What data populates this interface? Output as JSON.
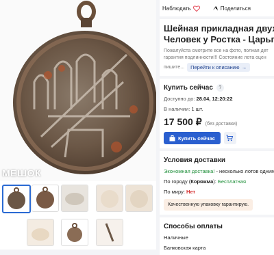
{
  "header": {
    "favorite_label": "Наблюдать",
    "share_label": "Поделиться"
  },
  "gallery": {
    "watermark": "МЕШОК"
  },
  "item": {
    "title_line1": "Шейная прикладная двухс",
    "title_line2": "Человек у Ростка - Царьгр",
    "desc_line1": "Пожалуйста смотрите все на фото, полная дет",
    "desc_line2": "гарантия подлинности!!! Состояние лота оцен",
    "desc_line3": "пишите...",
    "goto_desc_label": "Перейти к описанию"
  },
  "buy": {
    "section_title": "Купить сейчас",
    "help": "?",
    "available_label": "Доступно до:",
    "available_value": "28.04, 12:20:22",
    "stock_label": "В наличии:",
    "stock_value": "1 шт.",
    "price": "17 500 ₽",
    "price_note": "(без доставки)",
    "buy_button": "Купить сейчас"
  },
  "delivery": {
    "section_title": "Условия доставки",
    "economy_label": "Экономная доставка!",
    "economy_text": " - несколько лотов одним",
    "city_label": "По городу (",
    "city_name": "Коряжма",
    "city_sep": "): ",
    "city_value": "Бесплатная",
    "world_label": "По миру: ",
    "world_value": "Нет",
    "note": "Качественную упаковку гарантирую."
  },
  "payment": {
    "section_title": "Способы оплаты",
    "methods": [
      "Наличные",
      "Банковская карта"
    ]
  },
  "colors": {
    "accent": "#2a5fcf",
    "green": "#1f8f3a",
    "red": "#d32b2b"
  }
}
